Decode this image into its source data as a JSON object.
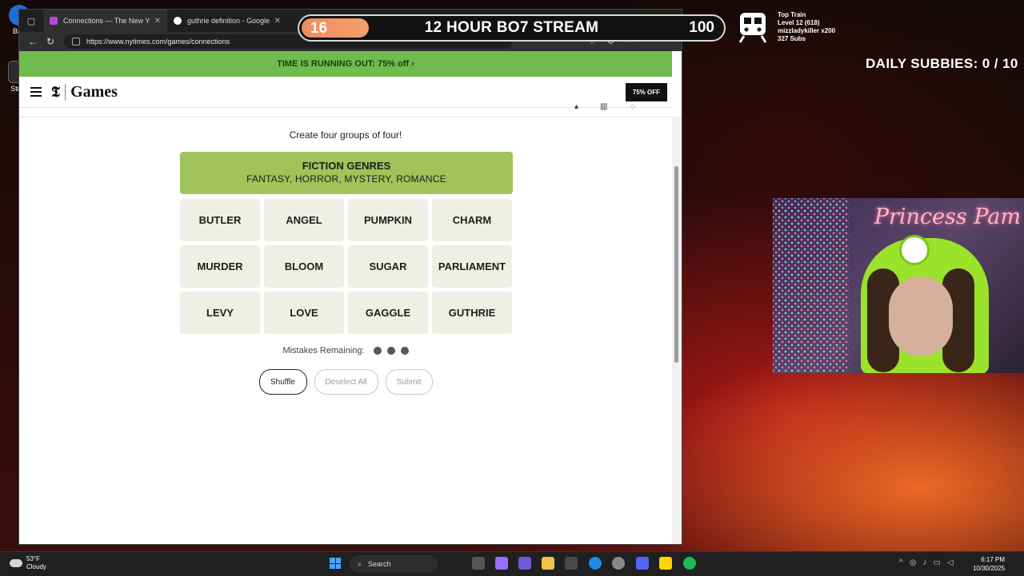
{
  "desktop": {
    "icons": [
      {
        "label": "Batt"
      },
      {
        "label": "Strea"
      }
    ]
  },
  "browser": {
    "tabs": [
      {
        "title": "Connections — The New York Times"
      },
      {
        "title": "guthrie definition - Google Search"
      }
    ],
    "url": "https://www.nytimes.com/games/connections"
  },
  "page": {
    "promo": "TIME IS RUNNING OUT:  75% off ›",
    "brand": "Games",
    "offer_button": "75% OFF",
    "instruction": "Create four groups of four!",
    "solved": [
      {
        "category": "FICTION GENRES",
        "members": "FANTASY, HORROR, MYSTERY, ROMANCE",
        "color": "#a0c35a"
      }
    ],
    "cards": [
      "BUTLER",
      "ANGEL",
      "PUMPKIN",
      "CHARM",
      "MURDER",
      "BLOOM",
      "SUGAR",
      "PARLIAMENT",
      "LEVY",
      "LOVE",
      "GAGGLE",
      "GUTHRIE"
    ],
    "mistakes_label": "Mistakes Remaining:",
    "mistakes_remaining": 3,
    "buttons": {
      "shuffle": "Shuffle",
      "deselect": "Deselect All",
      "submit": "Submit"
    }
  },
  "overlay": {
    "stream_current": "16",
    "stream_title": "12 HOUR BO7 STREAM",
    "stream_goal": "100",
    "stream_progress_fraction": 0.16,
    "train": {
      "title": "Top Train",
      "level": "Level 12  (618)",
      "user": "mizzladykiller x200",
      "subs": "327 Subs"
    },
    "daily_subbies": "DAILY SUBBIES:  0 / 10",
    "webcam_sign": "Princess Pam"
  },
  "taskbar": {
    "temp": "53°F",
    "condition": "Cloudy",
    "search": "Search",
    "time": "6:17 PM",
    "date": "10/30/2025"
  }
}
